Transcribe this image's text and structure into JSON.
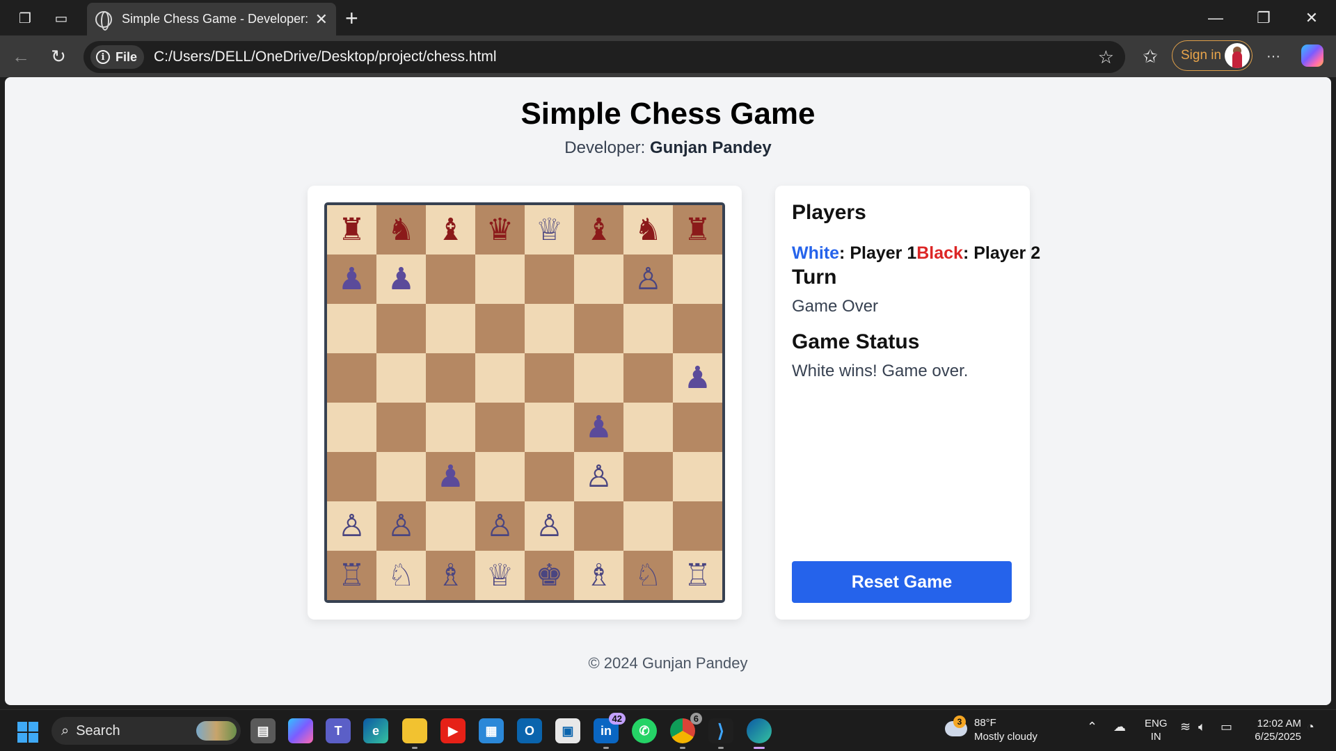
{
  "browser": {
    "tab_title": "Simple Chess Game - Developer: Gunjan Pandey",
    "tab_close": "✕",
    "new_tab": "+",
    "file_label": "File",
    "url": "C:/Users/DELL/OneDrive/Desktop/project/chess.html",
    "sign_in": "Sign in",
    "more": "···"
  },
  "page": {
    "title": "Simple Chess Game",
    "developer_label": "Developer: ",
    "developer_name": "Gunjan Pandey",
    "footer": "© 2024 Gunjan Pandey"
  },
  "board": {
    "light_color": "#f0d9b5",
    "dark_color": "#b58863",
    "white_piece_color": "#4a4580",
    "black_piece_color": "#8b1a1a",
    "pawn_filled_color": "#5b4b9a",
    "rows": [
      [
        {
          "p": "♜",
          "c": "black"
        },
        {
          "p": "♞",
          "c": "black"
        },
        {
          "p": "♝",
          "c": "black"
        },
        {
          "p": "♛",
          "c": "black"
        },
        {
          "p": "♕",
          "c": "white"
        },
        {
          "p": "♝",
          "c": "black"
        },
        {
          "p": "♞",
          "c": "black"
        },
        {
          "p": "♜",
          "c": "black"
        }
      ],
      [
        {
          "p": "♟",
          "c": "pawn"
        },
        {
          "p": "♟",
          "c": "pawn"
        },
        {
          "p": "",
          "c": ""
        },
        {
          "p": "",
          "c": ""
        },
        {
          "p": "",
          "c": ""
        },
        {
          "p": "",
          "c": ""
        },
        {
          "p": "♙",
          "c": "white"
        },
        {
          "p": "",
          "c": ""
        }
      ],
      [
        {
          "p": "",
          "c": ""
        },
        {
          "p": "",
          "c": ""
        },
        {
          "p": "",
          "c": ""
        },
        {
          "p": "",
          "c": ""
        },
        {
          "p": "",
          "c": ""
        },
        {
          "p": "",
          "c": ""
        },
        {
          "p": "",
          "c": ""
        },
        {
          "p": "",
          "c": ""
        }
      ],
      [
        {
          "p": "",
          "c": ""
        },
        {
          "p": "",
          "c": ""
        },
        {
          "p": "",
          "c": ""
        },
        {
          "p": "",
          "c": ""
        },
        {
          "p": "",
          "c": ""
        },
        {
          "p": "",
          "c": ""
        },
        {
          "p": "",
          "c": ""
        },
        {
          "p": "♟",
          "c": "pawn"
        }
      ],
      [
        {
          "p": "",
          "c": ""
        },
        {
          "p": "",
          "c": ""
        },
        {
          "p": "",
          "c": ""
        },
        {
          "p": "",
          "c": ""
        },
        {
          "p": "",
          "c": ""
        },
        {
          "p": "♟",
          "c": "pawn"
        },
        {
          "p": "",
          "c": ""
        },
        {
          "p": "",
          "c": ""
        }
      ],
      [
        {
          "p": "",
          "c": ""
        },
        {
          "p": "",
          "c": ""
        },
        {
          "p": "♟",
          "c": "pawn"
        },
        {
          "p": "",
          "c": ""
        },
        {
          "p": "",
          "c": ""
        },
        {
          "p": "♙",
          "c": "white"
        },
        {
          "p": "",
          "c": ""
        },
        {
          "p": "",
          "c": ""
        }
      ],
      [
        {
          "p": "♙",
          "c": "white"
        },
        {
          "p": "♙",
          "c": "white"
        },
        {
          "p": "",
          "c": ""
        },
        {
          "p": "♙",
          "c": "white"
        },
        {
          "p": "♙",
          "c": "white"
        },
        {
          "p": "",
          "c": ""
        },
        {
          "p": "",
          "c": ""
        },
        {
          "p": "",
          "c": ""
        }
      ],
      [
        {
          "p": "♖",
          "c": "white"
        },
        {
          "p": "♘",
          "c": "white"
        },
        {
          "p": "♗",
          "c": "white"
        },
        {
          "p": "♕",
          "c": "white"
        },
        {
          "p": "♚",
          "c": "white"
        },
        {
          "p": "♗",
          "c": "white"
        },
        {
          "p": "♘",
          "c": "white"
        },
        {
          "p": "♖",
          "c": "white"
        }
      ]
    ]
  },
  "info": {
    "players_heading": "Players",
    "white_label": "White",
    "white_player": ": Player 1",
    "black_label": "Black",
    "black_player": ": Player 2",
    "white_color": "#2563eb",
    "black_color": "#dc2626",
    "turn_heading": "Turn",
    "turn_value": "Game Over",
    "status_heading": "Game Status",
    "status_value": "White wins! Game over.",
    "reset_button": "Reset Game"
  },
  "taskbar": {
    "search_label": "Search",
    "linkedin_badge": "42",
    "chrome_badge": "6",
    "weather_badge": "3",
    "weather_temp": "88°F",
    "weather_condition": "Mostly cloudy",
    "lang_line1": "ENG",
    "lang_line2": "IN",
    "time": "12:02 AM",
    "date": "6/25/2025"
  }
}
